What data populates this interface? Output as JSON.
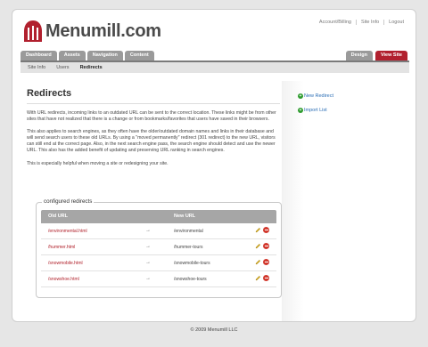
{
  "brand": {
    "name": "Menumill.com",
    "accent": "#b1202e"
  },
  "toplinks": [
    "Account/Billing",
    "Site Info",
    "Logout"
  ],
  "tabs": [
    "Dashboard",
    "Assets",
    "Navigation",
    "Content"
  ],
  "right_tabs": [
    {
      "label": "Design",
      "color": "#9a9a9a"
    },
    {
      "label": "View Site",
      "color": "#b1202e"
    }
  ],
  "subnav": [
    {
      "label": "Site Info",
      "active": false
    },
    {
      "label": "Users",
      "active": false
    },
    {
      "label": "Redirects",
      "active": true
    }
  ],
  "page": {
    "title": "Redirects",
    "paragraphs": [
      "With URL redirects, incoming links to an outdated URL can be sent to the correct location. These links might be from other sites that have not realized that there is a change or from bookmarks/favorites that users have saved in their browsers.",
      "This also applies to search engines, as they often have the older/outdated domain names and links in their database and will send search users to these old URLs. By using a \"moved permanently\" redirect (301 redirect) to the new URL, visitors can still end at the correct page. Also, in the next search engine pass, the search engine should detect and use the newer URL. This also has the added benefit of updating and preserving URL ranking in search engines.",
      "This is especially helpful when moving a site or redesigning your site."
    ]
  },
  "actions": {
    "new_redirect": "New Redirect",
    "import_list": "Import List"
  },
  "redirects": {
    "legend": "configured redirects",
    "columns": {
      "old": "Old URL",
      "new": "New URL"
    },
    "rows": [
      {
        "old": "/environmental.html",
        "new": "/environmental"
      },
      {
        "old": "/hummer.html",
        "new": "/hummer-tours"
      },
      {
        "old": "/snowmobile.html",
        "new": "/snowmobile-tours"
      },
      {
        "old": "/snowshoe.html",
        "new": "/snowshoe-tours"
      }
    ],
    "arrow": "→"
  },
  "footer": "© 2009 Menumill LLC"
}
